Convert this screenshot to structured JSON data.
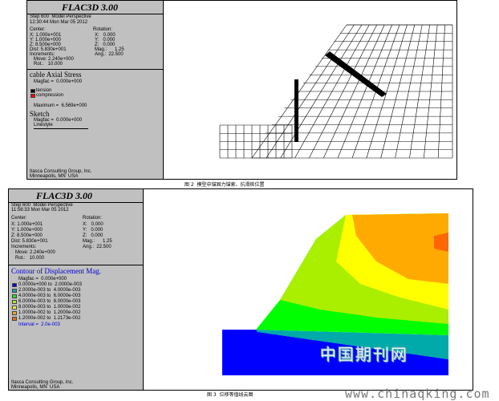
{
  "top": {
    "app_title": "FLAC3D 3.00",
    "step_line": "Step 600  Model Perspective",
    "time_line": "12:30:44 Mon Mar 05 2012",
    "center_label": "Center:",
    "center_x": "X: 1.000e+001",
    "center_y": "Y: 1.000e+000",
    "center_z": "Z: 8.500e+000",
    "dist": "Dist: 5.830e+001",
    "rotation_label": "Rotation:",
    "rot_x": "X:   0.000",
    "rot_y": "Y:   0.000",
    "rot_z": "Z:   0.000",
    "mag": "Mag.:      1.25",
    "ang": "Ang.:  22.500",
    "increments_label": "Increments:",
    "move": "Move: 2.240e+000",
    "rot": "Rot.:   10.000",
    "section_title": "cable Axial Stress",
    "magfac": "Magfac =  0.000e+000",
    "tension": "tension",
    "compression": "compression",
    "maximum": "Maximum =  6.569e+000",
    "sketch_title": "Sketch",
    "sketch_magfac": "Magfac =  0.000e+000",
    "linestyle": "Linestyle",
    "company_1": "Itasca Consulting Group, Inc.",
    "company_2": "Minneapolis, MN  USA",
    "caption": "图 2  模型中锚固力锚索、抗滑桩位置"
  },
  "bottom": {
    "app_title": "FLAC3D 3.00",
    "step_line": "Step 600  Model Perspective",
    "time_line": "11:56:33 Mon Mar 05 2012",
    "center_label": "Center:",
    "center_x": "X: 1.000e+001",
    "center_y": "Y: 1.000e+000",
    "center_z": "Z: 8.500e+000",
    "dist": "Dist: 5.830e+001",
    "rotation_label": "Rotation:",
    "rot_x": "X:   0.000",
    "rot_y": "Y:   0.000",
    "rot_z": "Z:   0.000",
    "mag": "Mag.:      1.25",
    "ang": "Ang.:  22.500",
    "increments_label": "Increments:",
    "move": "Move: 2.240e+000",
    "rot": "Rot.:   10.000",
    "section_title": "Contour of Displacement Mag.",
    "magfac": "Magfac =  0.000e+000",
    "legend": [
      {
        "label": "0.0000e+000 to  2.0000e-003",
        "color": "#0000ff"
      },
      {
        "label": "2.0000e-003 to  4.0000e-003",
        "color": "#00aaaa"
      },
      {
        "label": "4.0000e-003 to  6.0000e-003",
        "color": "#00ff00"
      },
      {
        "label": "6.0000e-003 to  8.0000e-003",
        "color": "#aaee00"
      },
      {
        "label": "8.0000e-003 to  1.0000e-002",
        "color": "#ffff00"
      },
      {
        "label": "1.0000e-002 to  1.2000e-002",
        "color": "#ffaa00"
      },
      {
        "label": "1.2000e-002 to  1.2173e-002",
        "color": "#ff6600"
      }
    ],
    "interval": "Interval =  2.0e-003",
    "company_1": "Itasca Consulting Group, Inc.",
    "company_2": "Minneapolis, MN  USA",
    "caption": "图 3  位移等值线云图",
    "watermark_cn": "中国期刊网",
    "watermark_url": "www.chinaqking.com"
  },
  "colors": {
    "panel_bg": "#c0c0c0",
    "view_bg": "#ffffff",
    "contour_title": "#0000cc",
    "tension": "#000000",
    "compression": "#ff0000"
  }
}
